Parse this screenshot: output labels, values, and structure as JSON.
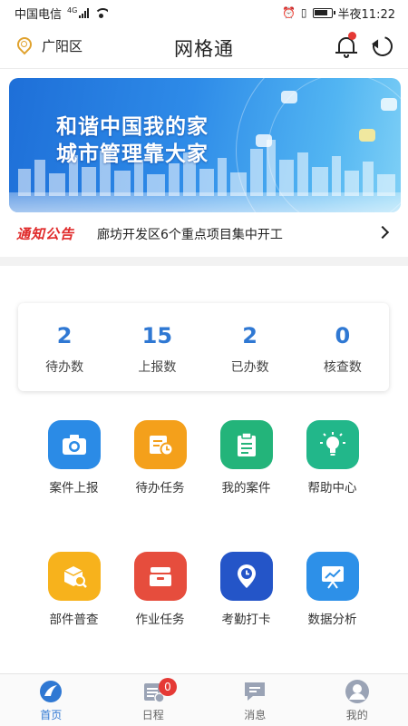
{
  "status_bar": {
    "carrier": "中国电信",
    "network": "4G",
    "time": "半夜11:22"
  },
  "header": {
    "location": "广阳区",
    "title": "网格通",
    "icons": [
      "location-pin-icon",
      "bell-icon",
      "refresh-icon"
    ]
  },
  "banner": {
    "line1": "和谐中国我的家",
    "line2": "城市管理靠大家"
  },
  "notice": {
    "tag": "通知公告",
    "text": "廊坊开发区6个重点项目集中开工"
  },
  "stats": [
    {
      "value": "2",
      "label": "待办数"
    },
    {
      "value": "15",
      "label": "上报数"
    },
    {
      "value": "2",
      "label": "已办数"
    },
    {
      "value": "0",
      "label": "核查数"
    }
  ],
  "functions": [
    {
      "label": "案件上报",
      "icon": "camera-icon",
      "color": "#2b8be6"
    },
    {
      "label": "待办任务",
      "icon": "task-clock-icon",
      "color": "#f4a01b"
    },
    {
      "label": "我的案件",
      "icon": "clipboard-icon",
      "color": "#23b47a"
    },
    {
      "label": "帮助中心",
      "icon": "lightbulb-icon",
      "color": "#22b78a"
    },
    {
      "label": "部件普查",
      "icon": "box-search-icon",
      "color": "#f7b21c"
    },
    {
      "label": "作业任务",
      "icon": "toolbox-icon",
      "color": "#e64d3d"
    },
    {
      "label": "考勤打卡",
      "icon": "clock-pin-icon",
      "color": "#2455c8"
    },
    {
      "label": "数据分析",
      "icon": "chart-board-icon",
      "color": "#2d90e8"
    }
  ],
  "tabbar": {
    "tabs": [
      {
        "label": "首页",
        "icon": "home-icon"
      },
      {
        "label": "日程",
        "icon": "schedule-icon"
      },
      {
        "label": "消息",
        "icon": "message-icon"
      },
      {
        "label": "我的",
        "icon": "user-icon"
      }
    ],
    "schedule_badge": "0",
    "active_color": "#2f78d3"
  }
}
